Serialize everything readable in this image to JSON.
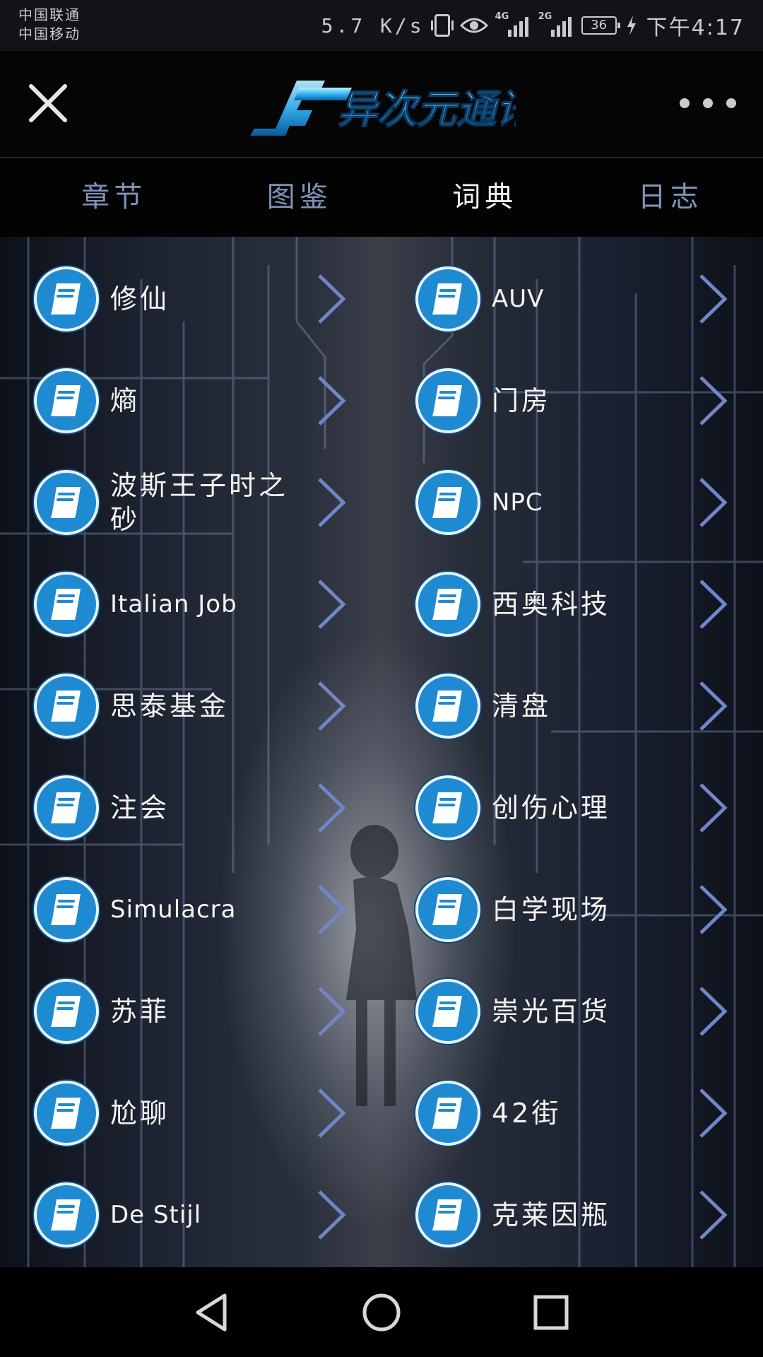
{
  "status_bar": {
    "carrier_1": "中国联通",
    "carrier_2": "中国移动",
    "net_speed": "5.7 K/s",
    "signal_1_tag": "4G",
    "signal_2_tag": "2G",
    "battery": "36",
    "time": "下午4:17"
  },
  "header": {
    "logo_text": "异次元通讯"
  },
  "tabs": [
    {
      "label": "章节"
    },
    {
      "label": "图鉴"
    },
    {
      "label": "词典"
    },
    {
      "label": "日志"
    }
  ],
  "active_tab": "词典",
  "entries_left": [
    {
      "label": "修仙"
    },
    {
      "label": "熵"
    },
    {
      "label": "波斯王子时之砂"
    },
    {
      "label": "Italian Job"
    },
    {
      "label": "思泰基金"
    },
    {
      "label": "注会"
    },
    {
      "label": "Simulacra"
    },
    {
      "label": "苏菲"
    },
    {
      "label": "尬聊"
    },
    {
      "label": "De Stijl"
    }
  ],
  "entries_right": [
    {
      "label": "AUV"
    },
    {
      "label": "门房"
    },
    {
      "label": "NPC"
    },
    {
      "label": "西奥科技"
    },
    {
      "label": "清盘"
    },
    {
      "label": "创伤心理"
    },
    {
      "label": "白学现场"
    },
    {
      "label": "崇光百货"
    },
    {
      "label": "42街"
    },
    {
      "label": "克莱因瓶"
    }
  ],
  "colors": {
    "icon_bg": "#1e8ad2",
    "tab_inactive": "#7f93b8",
    "tab_active": "#f2f2f2",
    "chevron": "#6f86c8"
  }
}
